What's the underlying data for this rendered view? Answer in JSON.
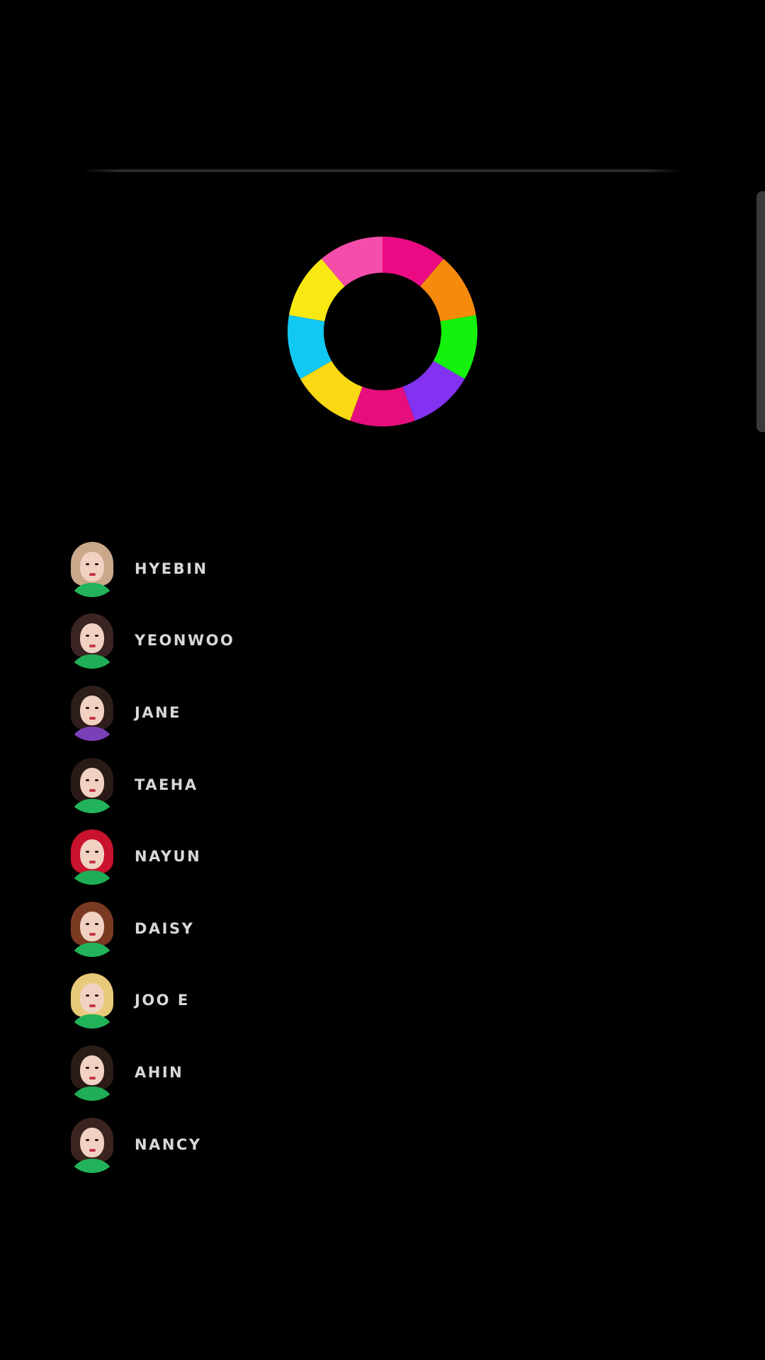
{
  "ring": {
    "segments": [
      {
        "color": "#EA0B84"
      },
      {
        "color": "#F68A0C"
      },
      {
        "color": "#14F10C"
      },
      {
        "color": "#8232F0"
      },
      {
        "color": "#E50E7C"
      },
      {
        "color": "#F9D814"
      },
      {
        "color": "#11C8F5"
      },
      {
        "color": "#FAE813"
      },
      {
        "color": "#F54EAA"
      }
    ]
  },
  "members": [
    {
      "name": "HYEBIN",
      "avatar_icon": "hyebin-avatar-icon",
      "hair": "#c9a98a",
      "shirt": "#22b35a"
    },
    {
      "name": "YEONWOO",
      "avatar_icon": "yeonwoo-avatar-icon",
      "hair": "#3a2424",
      "shirt": "#1fae55"
    },
    {
      "name": "JANE",
      "avatar_icon": "jane-avatar-icon",
      "hair": "#2d1d1b",
      "shirt": "#7b3fb7"
    },
    {
      "name": "TAEHA",
      "avatar_icon": "taeha-avatar-icon",
      "hair": "#2a1a17",
      "shirt": "#22b35a"
    },
    {
      "name": "NAYUN",
      "avatar_icon": "nayun-avatar-icon",
      "hair": "#c8122e",
      "shirt": "#1fae55"
    },
    {
      "name": "DAISY",
      "avatar_icon": "daisy-avatar-icon",
      "hair": "#7a3a22",
      "shirt": "#22b35a"
    },
    {
      "name": "JOO E",
      "avatar_icon": "jooe-avatar-icon",
      "hair": "#e8c97a",
      "shirt": "#22b35a"
    },
    {
      "name": "AHIN",
      "avatar_icon": "ahin-avatar-icon",
      "hair": "#2b1c18",
      "shirt": "#1fae55"
    },
    {
      "name": "NANCY",
      "avatar_icon": "nancy-avatar-icon",
      "hair": "#3b2420",
      "shirt": "#22b35a"
    }
  ]
}
